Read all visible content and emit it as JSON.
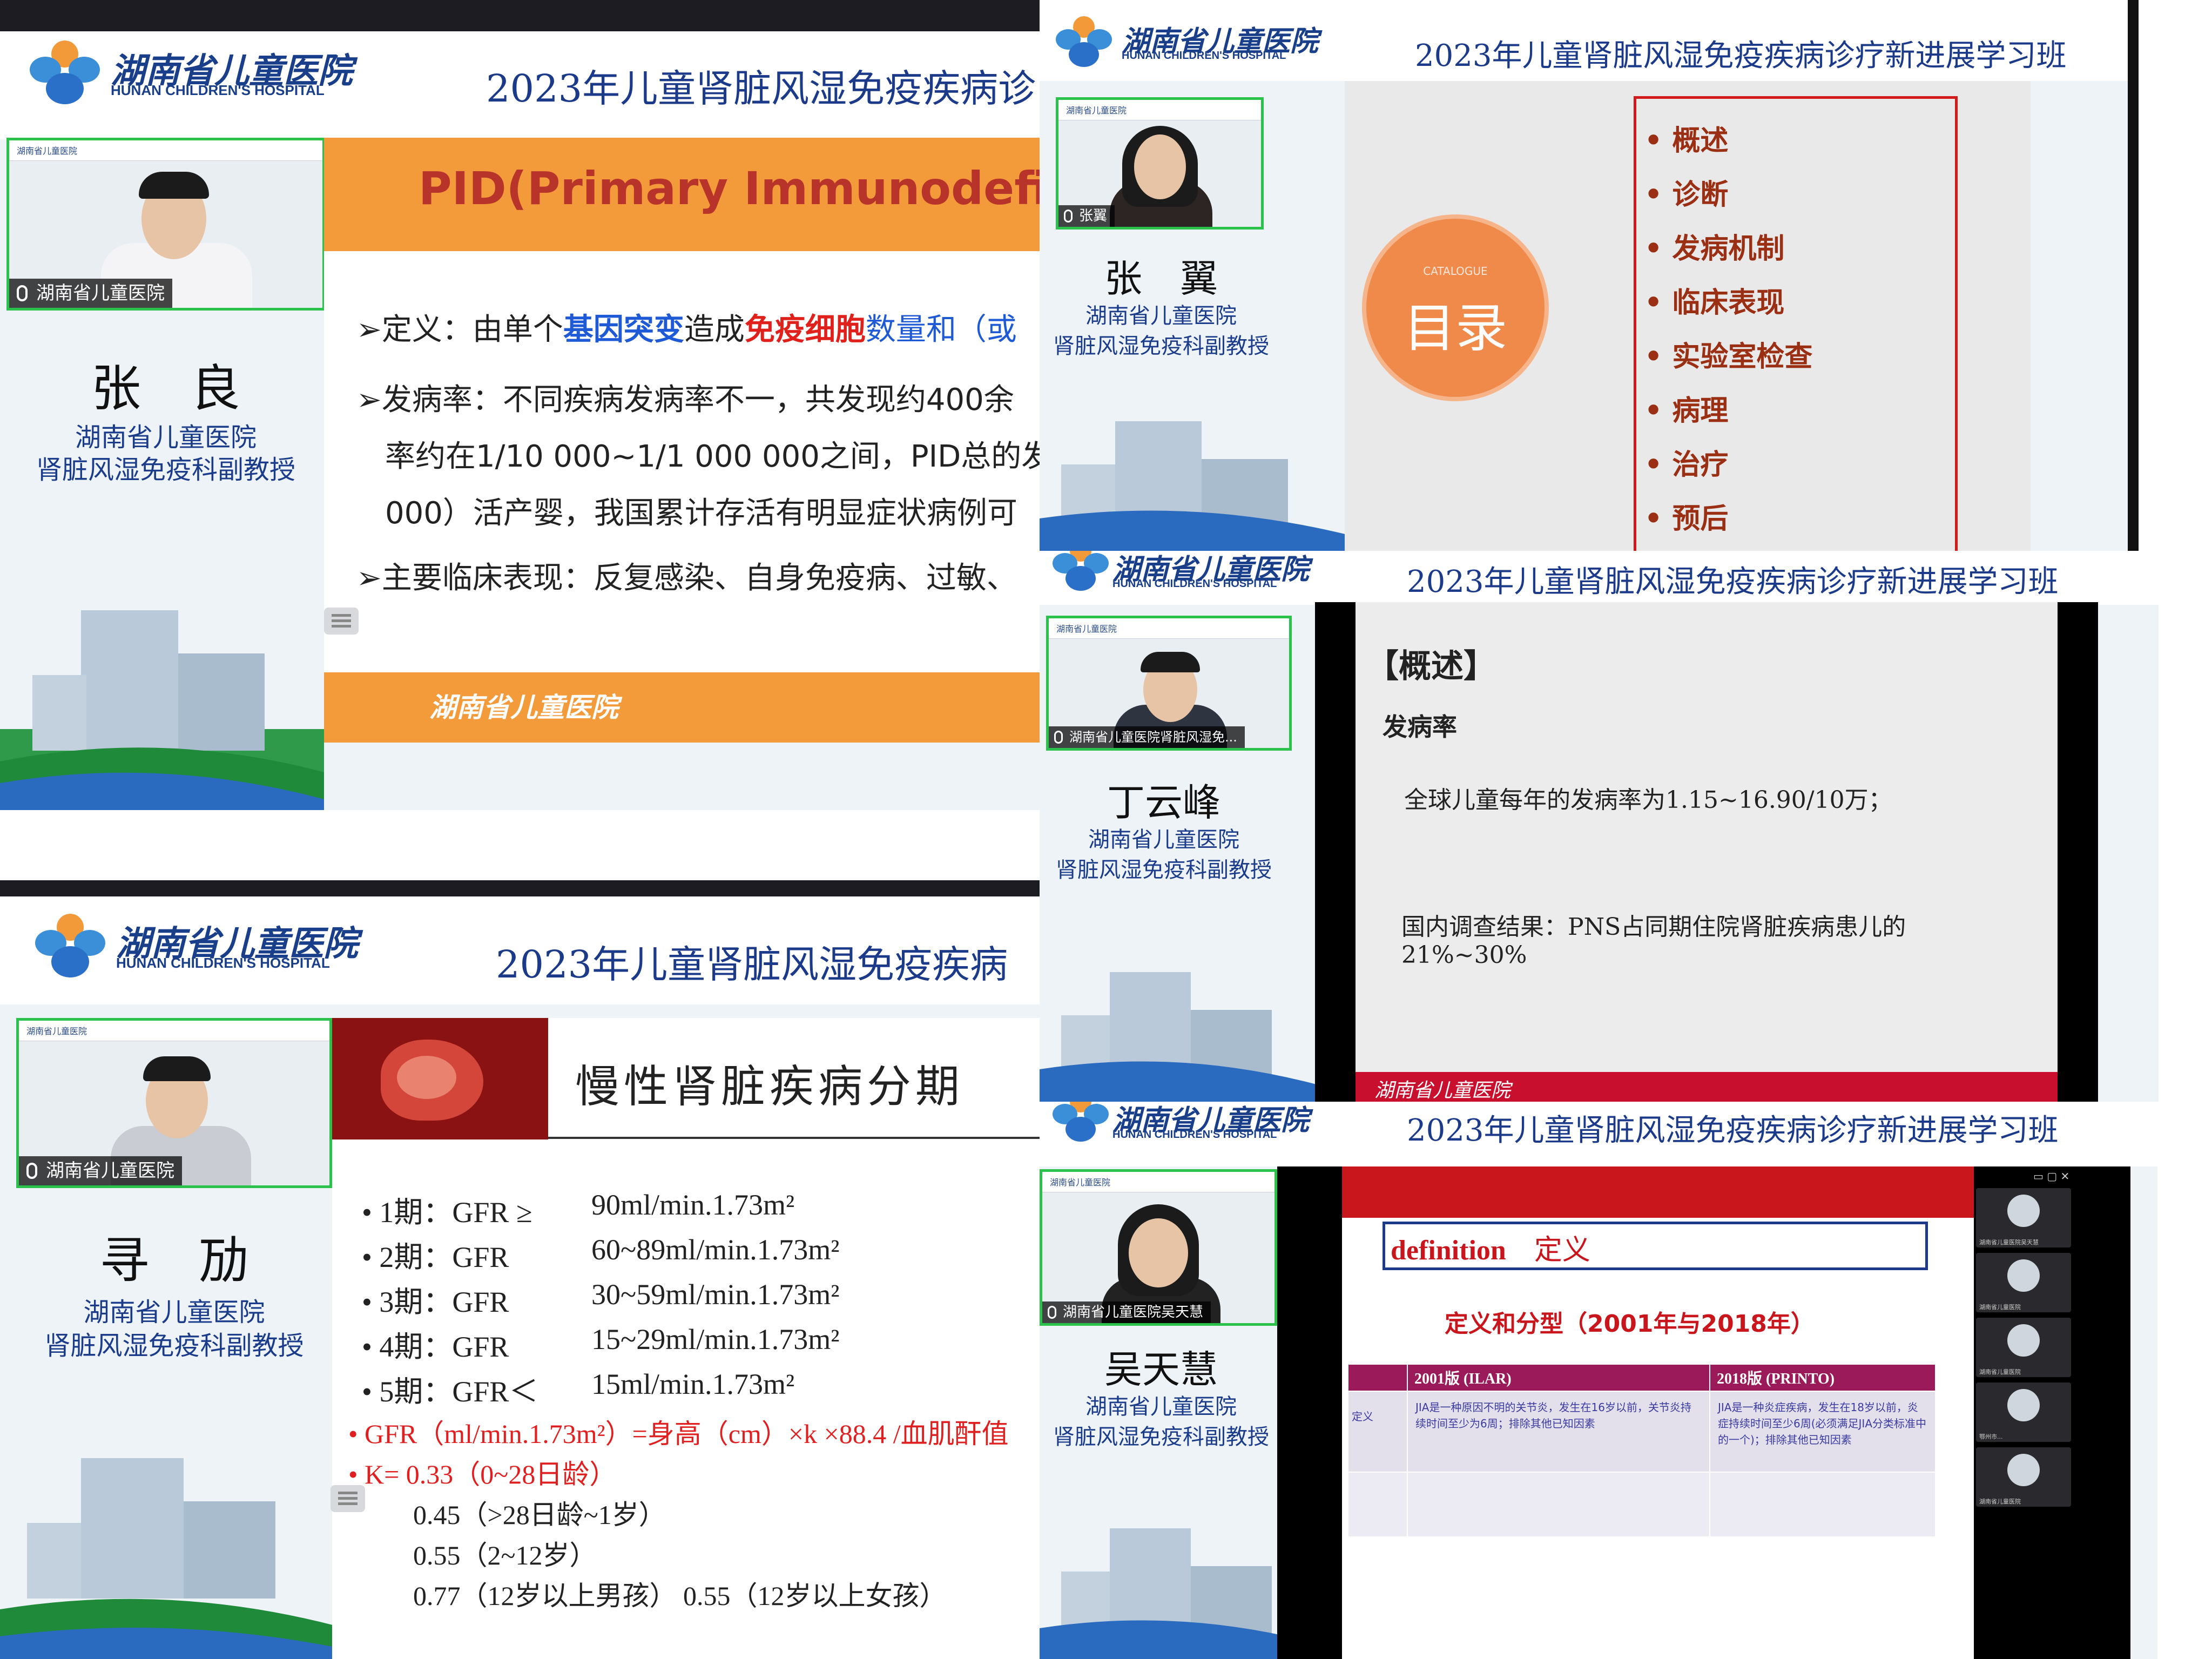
{
  "hospital": {
    "name_cn": "湖南省儿童医院",
    "name_en": "HUNAN CHILDREN'S HOSPITAL"
  },
  "course_title": "2023年儿童肾脏风湿免疫疾病诊疗新进展学习班",
  "course_title_clipped": "2023年儿童肾脏风湿免疫疾病诊",
  "course_title_clipped2": "2023年儿童肾脏风湿免疫疾病",
  "colors": {
    "brand_blue": "#1a3f8a",
    "accent_orange": "#f39a3a",
    "active_speaker": "#2ac24a",
    "slide_red": "#cf1f1f"
  },
  "panel1": {
    "camera_label": "湖南省儿童医院",
    "speaker_name": "张　良",
    "speaker_org": "湖南省儿童医院",
    "speaker_title": "肾脏风湿免疫科副教授",
    "slide_title": "PID(Primary Immunodeficien",
    "b1_marker": "➢",
    "b1_lead": "定义：由单个",
    "b1_hl1": "基因突变",
    "b1_mid": "造成",
    "b1_hl2": "免疫细胞",
    "b1_tail": "数量和（或",
    "b2_marker": "➢",
    "b2_l1": "发病率：不同疾病发病率不一，共发现约400余",
    "b2_l2": "率约在1/10 000~1/1 000 000之间，PID总的发",
    "b2_l3": "000）活产婴，我国累计存活有明显症状病例可",
    "b3_marker": "➢",
    "b3": "主要临床表现：反复感染、自身免疫病、过敏、",
    "footer_logo": "湖南省儿童医院"
  },
  "panel2": {
    "camera_label": "张翼",
    "speaker_name": "张　翼",
    "speaker_org": "湖南省儿童医院",
    "speaker_title": "肾脏风湿免疫科副教授",
    "catalogue_en": "CATALOGUE",
    "catalogue_cn": "目录",
    "items": [
      "• 概述",
      "• 诊断",
      "• 发病机制",
      "• 临床表现",
      "• 实验室检查",
      "• 病理",
      "• 治疗",
      "• 预后"
    ]
  },
  "panel3": {
    "camera_label": "湖南省儿童医院肾脏风湿免...",
    "speaker_name": "丁云峰",
    "speaker_org": "湖南省儿童医院",
    "speaker_title": "肾脏风湿免疫科副教授",
    "section": "【概述】",
    "heading": "发病率",
    "line1": "全球儿童每年的发病率为1.15~16.90/10万；",
    "line2": "国内调查结果：PNS占同期住院肾脏疾病患儿的",
    "line3": "21%~30%",
    "footer_logo": "湖南省儿童医院"
  },
  "panel4": {
    "camera_label": "湖南省儿童医院",
    "speaker_name": "寻　劢",
    "speaker_org": "湖南省儿童医院",
    "speaker_title": "肾脏风湿免疫科副教授",
    "slide_title": "慢性肾脏疾病分期",
    "stages": [
      {
        "label": "• 1期：GFR ≥",
        "value": "90ml/min.1.73m²"
      },
      {
        "label": "• 2期：GFR",
        "value": "60~89ml/min.1.73m²"
      },
      {
        "label": "• 3期：GFR",
        "value": "30~59ml/min.1.73m²"
      },
      {
        "label": "• 4期：GFR",
        "value": "15~29ml/min.1.73m²"
      },
      {
        "label": "• 5期：GFR＜",
        "value": "15ml/min.1.73m²"
      }
    ],
    "formula": "• GFR（ml/min.1.73m²）=身高（cm）×k ×88.4 /血肌酐值",
    "k_line": "• K= 0.33（0~28日龄）",
    "k2": "0.45（>28日龄~1岁）",
    "k3": "0.55（2~12岁）",
    "k4": "0.77（12岁以上男孩） 0.55（12岁以上女孩）"
  },
  "panel5": {
    "camera_label": "湖南省儿童医院吴天慧",
    "speaker_name": "吴天慧",
    "speaker_org": "湖南省儿童医院",
    "speaker_title": "肾脏风湿免疫科副教授",
    "def_en": "definition",
    "def_cn": "定义",
    "subtitle": "定义和分型（2001年与2018年）",
    "col1": "2001版 (ILAR)",
    "col2": "2018版 (PRINTO)",
    "row_label": "定义",
    "cell1": "JIA是一种原因不明的关节炎，发生在16岁以前，关节炎持续时间至少为6周；排除其他已知因素",
    "cell2": "JIA是一种炎症疾病，发生在18岁以前，炎症持续时间至少6周(必须满足JIA分类标准中的一个)；排除其他已知因素",
    "thumbs": [
      "湖南省儿童医院吴天慧",
      "湖南省儿童医院",
      "湖南省儿童医院",
      "鄂州市...",
      "湖南省儿童医院"
    ]
  }
}
